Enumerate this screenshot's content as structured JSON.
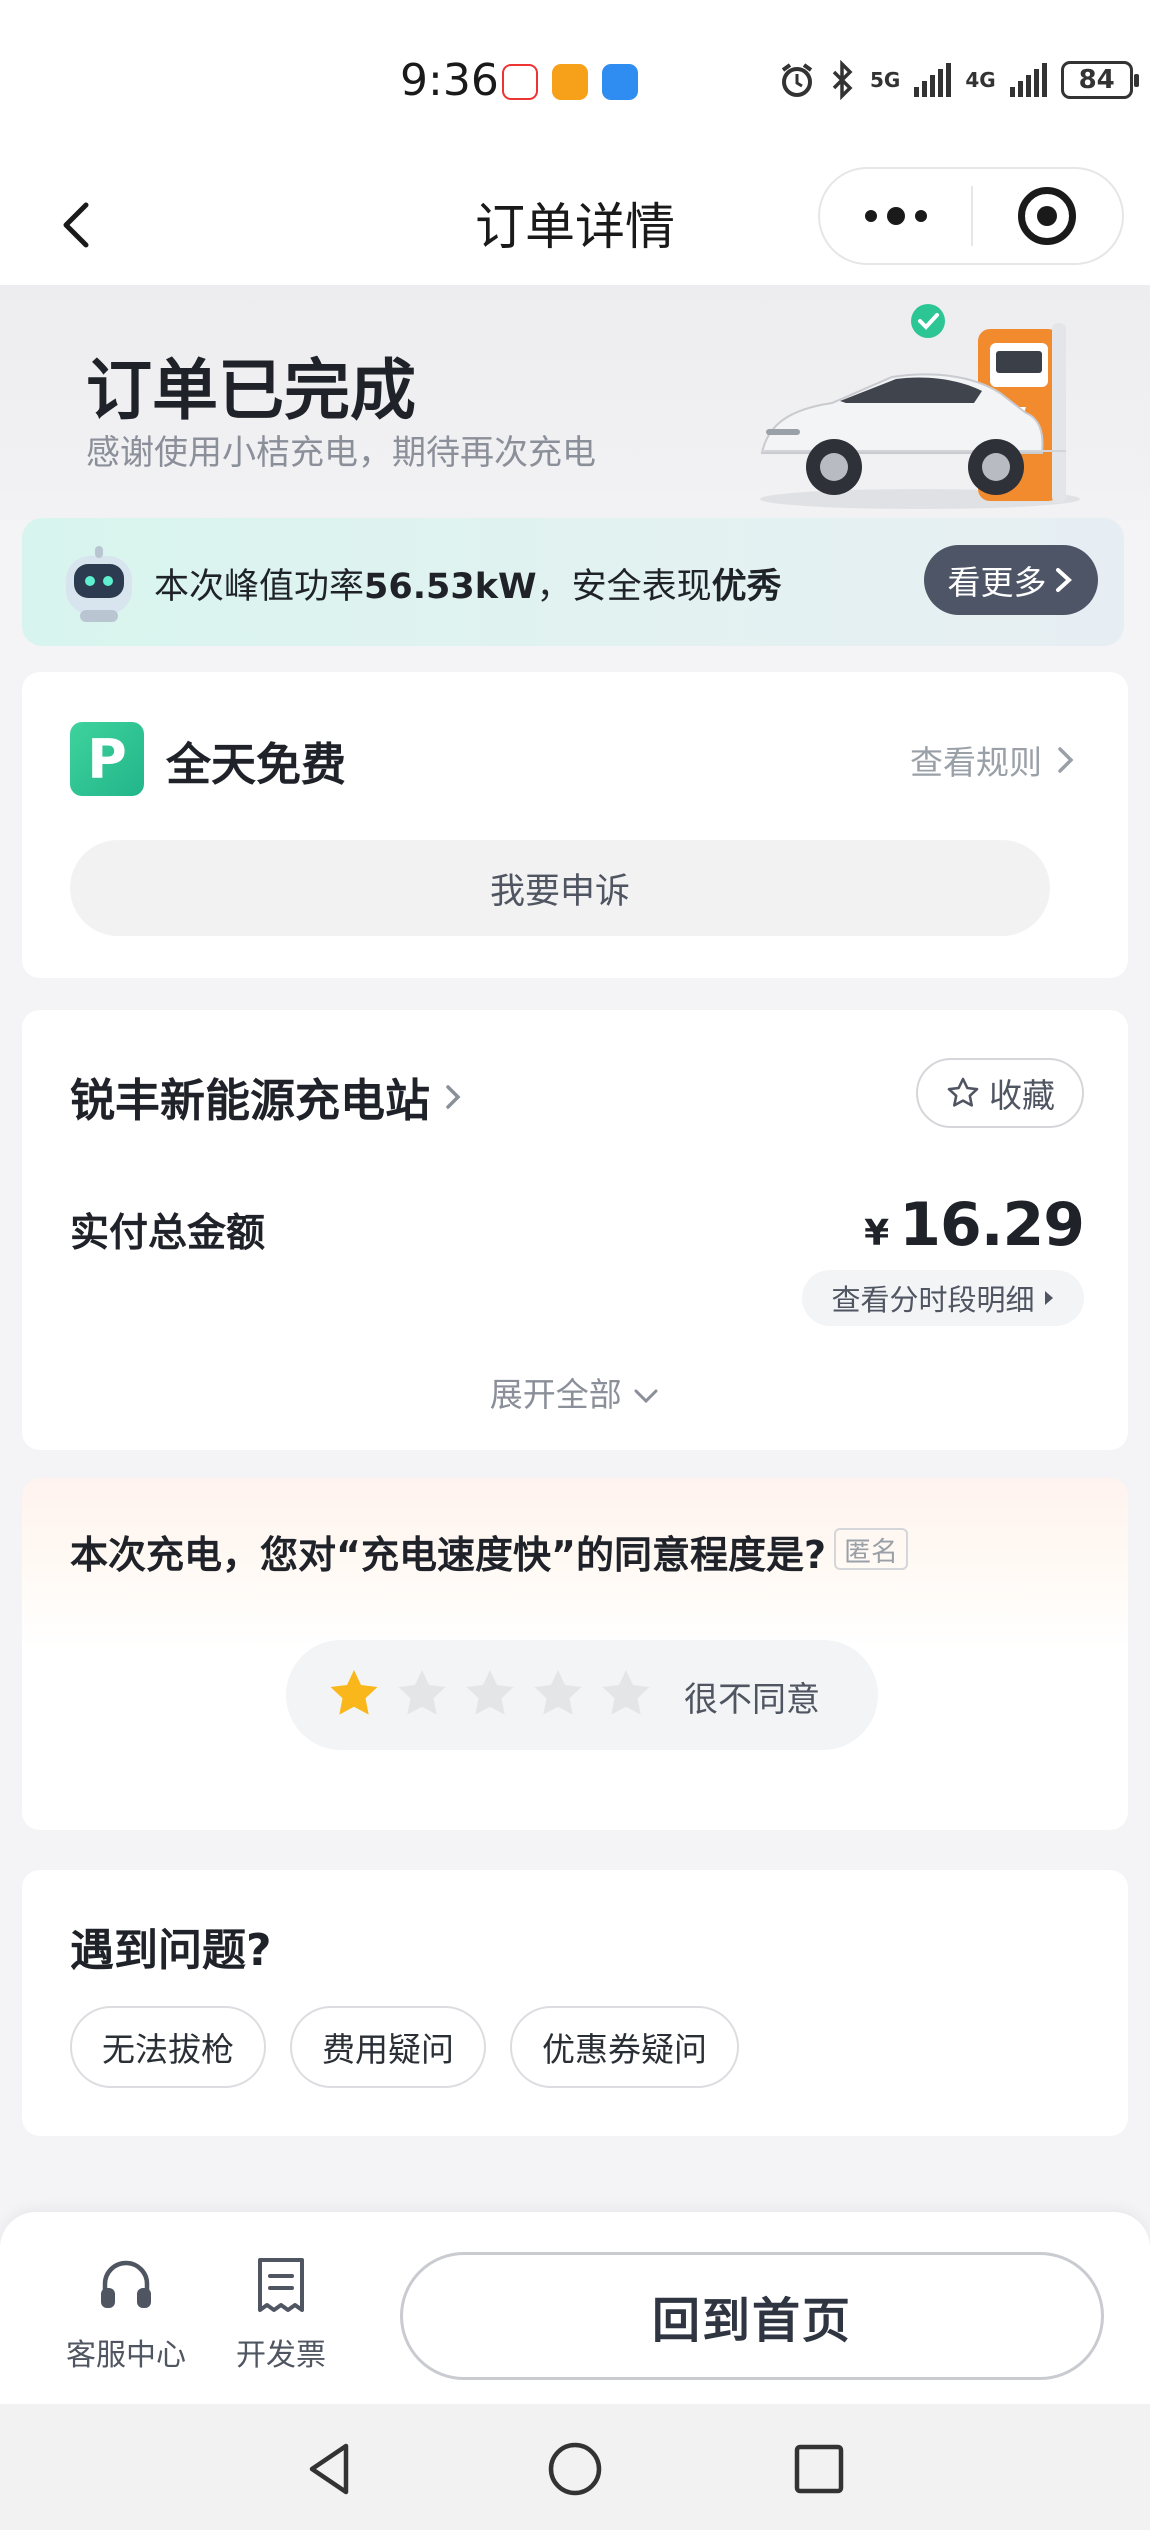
{
  "status_bar": {
    "time": "9:36",
    "network_1": "5G",
    "network_2": "4G",
    "battery": "84"
  },
  "nav": {
    "title": "订单详情"
  },
  "hero": {
    "title": "订单已完成",
    "subtitle": "感谢使用小桔充电，期待再次充电"
  },
  "banner": {
    "text_prefix": "本次峰值功率",
    "power": "56.53kW",
    "text_mid": "，安全表现",
    "rating": "优秀",
    "more_label": "看更多"
  },
  "parking": {
    "icon_letter": "P",
    "title": "全天免费",
    "rules_label": "查看规则",
    "appeal_label": "我要申诉"
  },
  "station": {
    "name": "锐丰新能源充电站",
    "fav_label": "收藏",
    "paid_label": "实付总金额",
    "currency": "¥",
    "amount": "16.29",
    "period_detail": "查看分时段明细",
    "expand_label": "展开全部"
  },
  "survey": {
    "question": "本次充电，您对“充电速度快”的同意程度是?",
    "anon_tag": "匿名",
    "rating": 1,
    "max_rating": 5,
    "rating_text": "很不同意"
  },
  "issues": {
    "title": "遇到问题?",
    "chips": [
      "无法拔枪",
      "费用疑问",
      "优惠券疑问"
    ]
  },
  "bottom_bar": {
    "service_label": "客服中心",
    "invoice_label": "开发票",
    "home_label": "回到首页"
  },
  "colors": {
    "accent_green": "#2cc594",
    "banner_btn": "#4d5566",
    "star_active": "#f9b71b",
    "star_inactive": "#e4e5e7"
  }
}
